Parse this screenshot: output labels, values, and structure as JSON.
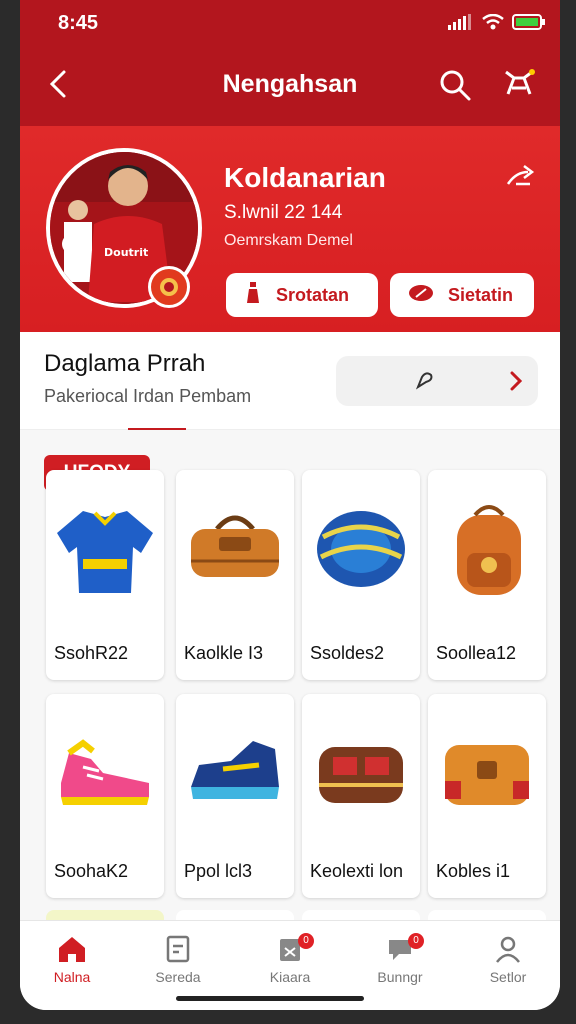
{
  "status_bar": {
    "time": "8:45"
  },
  "header": {
    "title": "Nengahsan"
  },
  "profile": {
    "name": "Koldanarian",
    "line1": "S.lwnil 22 144",
    "line2": "Oemrskam Demel",
    "jersey_text": "Doutrit",
    "buttons": [
      {
        "label": "Srotatan",
        "icon": "bottle-icon"
      },
      {
        "label": "Sietatin",
        "icon": "football-icon"
      }
    ]
  },
  "section": {
    "title": "Daglama Prrah",
    "subtitle": "Pakeriocal Irdan Pembam"
  },
  "badge": "UFODY",
  "products": [
    {
      "label": "SsohR22",
      "icon": "jersey-icon"
    },
    {
      "label": "Kaolkle I3",
      "icon": "bag-icon"
    },
    {
      "label": "Ssoldes2",
      "icon": "ball-ring-icon"
    },
    {
      "label": "Soollea12",
      "icon": "backpack-icon"
    },
    {
      "label": "SoohaK2",
      "icon": "sneaker-icon"
    },
    {
      "label": "Ppol lcl3",
      "icon": "shoe-icon"
    },
    {
      "label": "Keolexti lon",
      "icon": "pouch-icon"
    },
    {
      "label": "Kobles i1",
      "icon": "case-icon"
    }
  ],
  "nav": [
    {
      "label": "Nalna",
      "icon": "home-icon",
      "badge": ""
    },
    {
      "label": "Sereda",
      "icon": "book-icon",
      "badge": ""
    },
    {
      "label": "Kiaara",
      "icon": "clipboard-icon",
      "badge": "0"
    },
    {
      "label": "Bunngr",
      "icon": "chat-icon",
      "badge": "0"
    },
    {
      "label": "Setlor",
      "icon": "user-icon",
      "badge": ""
    }
  ],
  "colors": {
    "brand_red": "#b3161e",
    "accent_red": "#d01e23"
  }
}
